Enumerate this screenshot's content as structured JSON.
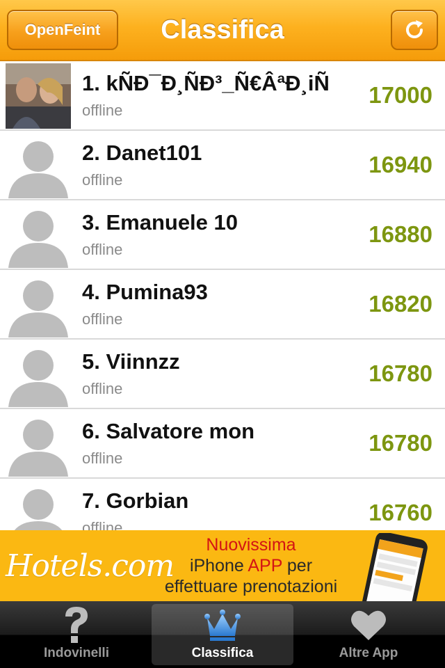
{
  "header": {
    "left_button": "OpenFeint",
    "title": "Classifica",
    "refresh_icon": "refresh-icon"
  },
  "leaderboard": [
    {
      "rank_name": "1. kÑÐ¯Ð¸ÑÐ³_Ñ€ÂªÐ¸iÑ",
      "status": "offline",
      "score": "17000",
      "avatar": "photo"
    },
    {
      "rank_name": "2. Danet101",
      "status": "offline",
      "score": "16940",
      "avatar": "placeholder"
    },
    {
      "rank_name": "3. Emanuele 10",
      "status": "offline",
      "score": "16880",
      "avatar": "placeholder"
    },
    {
      "rank_name": "4. Pumina93",
      "status": "offline",
      "score": "16820",
      "avatar": "placeholder"
    },
    {
      "rank_name": "5. Viinnzz",
      "status": "offline",
      "score": "16780",
      "avatar": "placeholder"
    },
    {
      "rank_name": "6. Salvatore mon",
      "status": "offline",
      "score": "16780",
      "avatar": "placeholder"
    },
    {
      "rank_name": "7. Gorbian",
      "status": "offline",
      "score": "16760",
      "avatar": "placeholder"
    }
  ],
  "ad": {
    "logo": "Hotels.com",
    "line1": "Nuovissima",
    "line2a": "iPhone ",
    "line2b": "APP",
    "line2c": " per",
    "line3": "effettuare prenotazioni"
  },
  "tabs": [
    {
      "label": "Indovinelli",
      "icon": "question-mark-icon",
      "active": false
    },
    {
      "label": "Classifica",
      "icon": "crown-icon",
      "active": true
    },
    {
      "label": "Altre App",
      "icon": "heart-icon",
      "active": false
    }
  ],
  "colors": {
    "header_orange": "#fdb11f",
    "score_green": "#7d9610",
    "ad_background": "#fbb812",
    "tab_active_icon": "#3d8fe0"
  }
}
